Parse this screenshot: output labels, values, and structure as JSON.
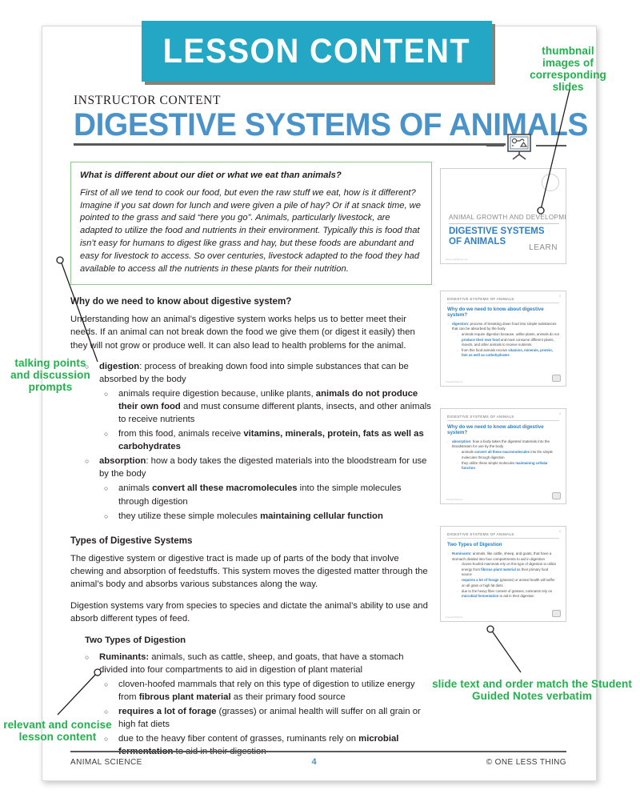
{
  "banner": {
    "label": "LESSON CONTENT"
  },
  "header": {
    "eyebrow": "INSTRUCTOR CONTENT",
    "title": "DIGESTIVE SYSTEMS OF ANIMALS",
    "icon": "easel-presentation-icon"
  },
  "callout": {
    "question": "What is different about our diet or what we eat than animals?",
    "answer": "First of all we tend to cook our food, but even the raw stuff we eat, how is it different? Imagine if you sat down for lunch and were given a pile of hay? Or if at snack time, we pointed to the grass and said “here you go”. Animals, particularly livestock, are adapted to utilize the food and nutrients in their environment. Typically this is food that isn’t easy for humans to digest like grass and hay, but these foods are abundant and easy for livestock to access. So over centuries, livestock adapted to the food they had available to access all the nutrients in these plants for their nutrition."
  },
  "section_why": {
    "heading": "Why do we need to know about digestive system?",
    "paragraph": "Understanding how an animal’s digestive system works helps us to better meet their needs. If an animal can not break down the food we give them (or digest it easily) then they will not grow or produce well. It can also lead to health problems for the animal.",
    "bullets": [
      {
        "lead": "digestion",
        "text": ": process of breaking down food into simple substances that can be absorbed by the body",
        "children": [
          {
            "html": "animals require digestion because, unlike plants, <b>animals do not produce their own food</b> and must consume different plants, insects, and other animals to receive nutrients"
          },
          {
            "html": "from this food, animals receive <b>vitamins, minerals, protein, fats as well as carbohydrates</b>"
          }
        ]
      },
      {
        "lead": "absorption",
        "text": ": how a body takes the digested materials into the bloodstream for use by the body",
        "children": [
          {
            "html": "animals <b>convert all these macromolecules</b> into the simple molecules through digestion"
          },
          {
            "html": "they utilize these simple molecules <b>maintaining cellular function</b>"
          }
        ]
      }
    ]
  },
  "section_types": {
    "heading": "Types of Digestive Systems",
    "paragraph1": "The digestive system or digestive tract is made up of parts of the body that involve chewing and absorption of feedstuffs. This system moves the digested matter through the animal’s body and absorbs various substances along the way.",
    "paragraph2": "Digestion systems vary from species to species and dictate the animal’s ability to use and absorb different types of feed.",
    "subheading": "Two Types of Digestion",
    "bullets": [
      {
        "lead": "Ruminants:",
        "text": " animals, such as cattle, sheep, and goats, that have a stomach divided into four compartments to aid in digestion of plant material",
        "children": [
          {
            "html": "cloven-hoofed mammals that rely on this type of digestion to utilize energy from <b>fibrous plant material</b> as their primary food source"
          },
          {
            "html": "<b>requires a lot of forage</b> (grasses) or animal health will suffer on all grain or high fat diets"
          },
          {
            "html": "due to the heavy fiber content of grasses, ruminants rely on <b>microbial fermentation</b> to aid in their digestion"
          }
        ]
      }
    ]
  },
  "thumbnails": [
    {
      "type": "title-slide",
      "kicker": "ANIMAL GROWTH AND DEVELOPMENT",
      "title": "DIGESTIVE SYSTEMS OF ANIMALS",
      "cta": "LEARN",
      "footer": "OneLessThing.net"
    },
    {
      "type": "content-slide",
      "kicker": "DIGESTIVE SYSTEMS OF ANIMALS",
      "heading": "Why do we need to know about digestive system?",
      "number": "2",
      "items": [
        {
          "html": "<span class=\"hl\">digestion</span>: process of breaking down food into simple substances that can be absorbed by the body",
          "children": [
            "animals require digestion because, unlike plants, animals do not <span class=\"hl\">produce their own food</span> and must consume different plants, insects, and other animals to receive nutrients",
            "from this food animals receive <span class=\"hl\">vitamins, minerals, protein, fats as well as carbohydrates</span>"
          ]
        }
      ],
      "footer": "OneLessThing.net"
    },
    {
      "type": "content-slide",
      "kicker": "DIGESTIVE SYSTEMS OF ANIMALS",
      "heading": "Why do we need to know about digestive system?",
      "number": "3",
      "items": [
        {
          "html": "<span class=\"hl\">absorption</span>: how a body takes the digested materials into the bloodstream for use by the body",
          "children": [
            "animals <span class=\"hl\">convert all these macromolecules</span> into the simple molecules through digestion",
            "they utilize these simple molecules <span class=\"hl\">maintaining cellular function</span>"
          ]
        }
      ],
      "footer": "OneLessThing.net"
    },
    {
      "type": "content-slide",
      "kicker": "DIGESTIVE SYSTEMS OF ANIMALS",
      "heading": "Two Types of Digestion",
      "number": "4",
      "items": [
        {
          "html": "<span class=\"hl\">Ruminants</span>: animals, like cattle, sheep, and goats, that have a stomach divided into four compartments to aid in digestion",
          "children": [
            "cloven-hoofed mammals rely on this type of digestion to utilize energy from <span class=\"hl\">fibrous plant material</span> as their primary food source",
            "<span class=\"hl\">requires a lot of forage</span> (grasses) or animal health will suffer on all grain or high fat diets",
            "due to the heavy fiber content of grasses, ruminants rely on <span class=\"hl\">microbial fermentation</span> to aid in their digestion"
          ]
        }
      ],
      "footer": "OneLessThing.net"
    }
  ],
  "annotations": {
    "thumbnails": "thumbnail images of corresponding slides",
    "talking_points": "talking points and discussion prompts",
    "relevant": "relevant and concise lesson content",
    "slide_match": "slide text and order match the Student Guided Notes verbatim"
  },
  "footer": {
    "left": "ANIMAL SCIENCE",
    "page": "4",
    "right": "© ONE LESS THING"
  },
  "colors": {
    "banner_bg": "#23a7c4",
    "title_blue": "#4a93c9",
    "annotation_green": "#22b14c",
    "callout_border": "#8dc98d",
    "slide_blue": "#2f7fc1"
  }
}
